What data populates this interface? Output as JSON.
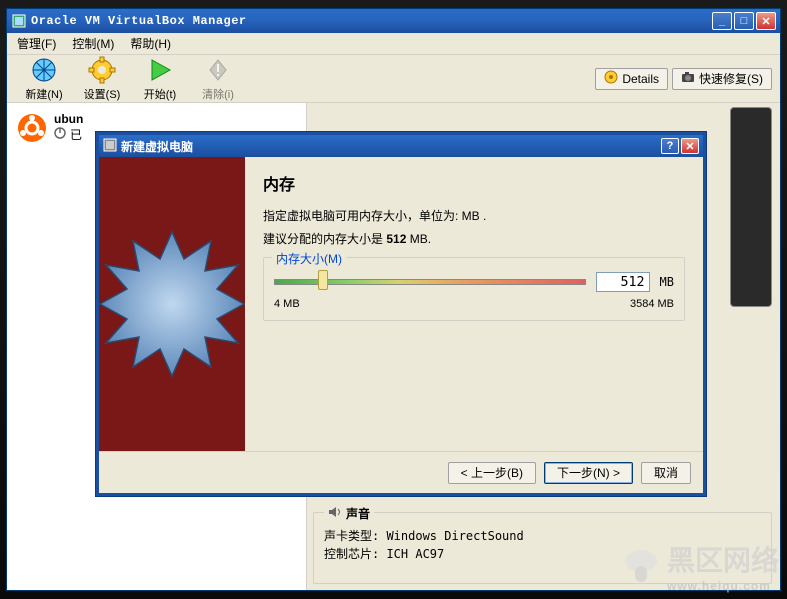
{
  "window": {
    "title": "Oracle VM VirtualBox Manager"
  },
  "menubar": {
    "file": "管理(F)",
    "machine": "控制(M)",
    "help": "帮助(H)"
  },
  "toolbar": {
    "new": "新建(N)",
    "settings": "设置(S)",
    "start": "开始(t)",
    "discard": "清除(i)",
    "details": "Details",
    "snapshot": "快速修复(S)"
  },
  "vm": {
    "name": "ubun",
    "state_prefix": "已"
  },
  "wizard": {
    "title": "新建虚拟电脑",
    "heading": "内存",
    "desc": "指定虚拟电脑可用内存大小，单位为: MB .",
    "reco_prefix": "建议分配的内存大小是 ",
    "reco_val": "512",
    "reco_suffix": " MB.",
    "field_legend": "内存大小(M)",
    "slider_min": "4 MB",
    "slider_max": "3584 MB",
    "value": "512",
    "unit": "MB",
    "back": "< 上一步(B)",
    "next": "下一步(N) >",
    "cancel": "取消"
  },
  "sound": {
    "group_title": "声音",
    "line1_label": "声卡类型: ",
    "line1_value": "Windows DirectSound",
    "line2_label": "控制芯片: ",
    "line2_value": "ICH AC97"
  },
  "watermark": {
    "text": "黑区网络",
    "sub": "www.heiqu.com"
  }
}
